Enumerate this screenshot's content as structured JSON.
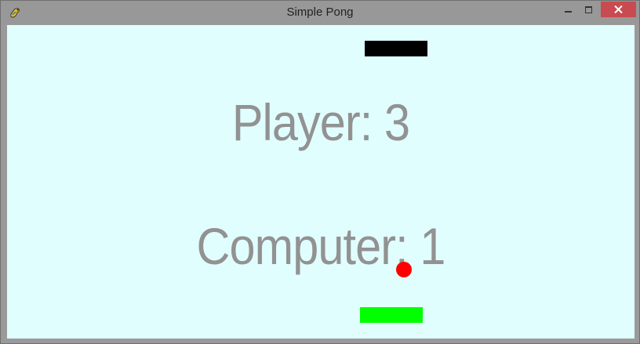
{
  "window": {
    "title": "Simple Pong",
    "icon": "pygame-snake-icon"
  },
  "controls": {
    "minimize_icon": "minimize-icon",
    "maximize_icon": "maximize-icon",
    "close_icon": "close-icon"
  },
  "game": {
    "player_score_text": "Player: 3",
    "computer_score_text": "Computer: 1",
    "player_score": 3,
    "computer_score": 1
  },
  "colors": {
    "background": "#e1fefe",
    "score_text": "#929292",
    "top_paddle": "#000000",
    "bottom_paddle": "#00ff00",
    "ball": "#ff0000",
    "close_button": "#c74b50"
  }
}
